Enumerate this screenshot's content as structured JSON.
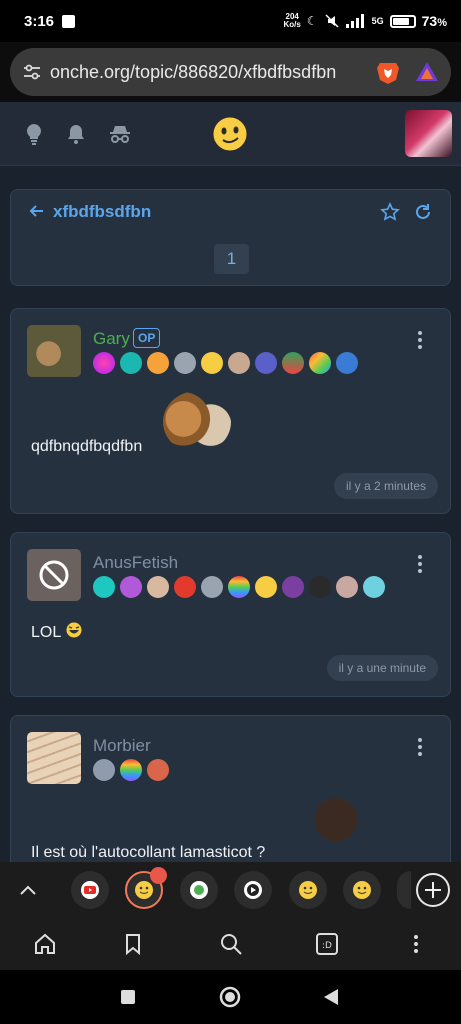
{
  "status_bar": {
    "time": "3:16",
    "net_speed_value": "204",
    "net_speed_unit": "Ko/s",
    "signal": "5G",
    "battery_percent": "73",
    "battery_suffix": "%",
    "battery_level": 0.73
  },
  "browser": {
    "url": "onche.org/topic/886820/xfbdfbsdfbn"
  },
  "topic": {
    "title": "xfbdfbsdfbn",
    "current_page": "1"
  },
  "posts": [
    {
      "author": "Gary",
      "author_color": "#4caf50",
      "op_label": "OP",
      "content": "qdfbnqdfbqdfbn",
      "time": "il y a 2 minutes",
      "badge_count": 10
    },
    {
      "author": "AnusFetish",
      "author_color": "#7f8fa3",
      "content": "LOL",
      "time": "il y a une minute",
      "badge_count": 11
    },
    {
      "author": "Morbier",
      "author_color": "#7f8fa3",
      "content": "Il est où l'autocollant lamasticot ?",
      "badge_count": 3
    }
  ],
  "colors": {
    "accent": "#5aa6ec",
    "background": "#1a222e",
    "card": "#263140"
  }
}
